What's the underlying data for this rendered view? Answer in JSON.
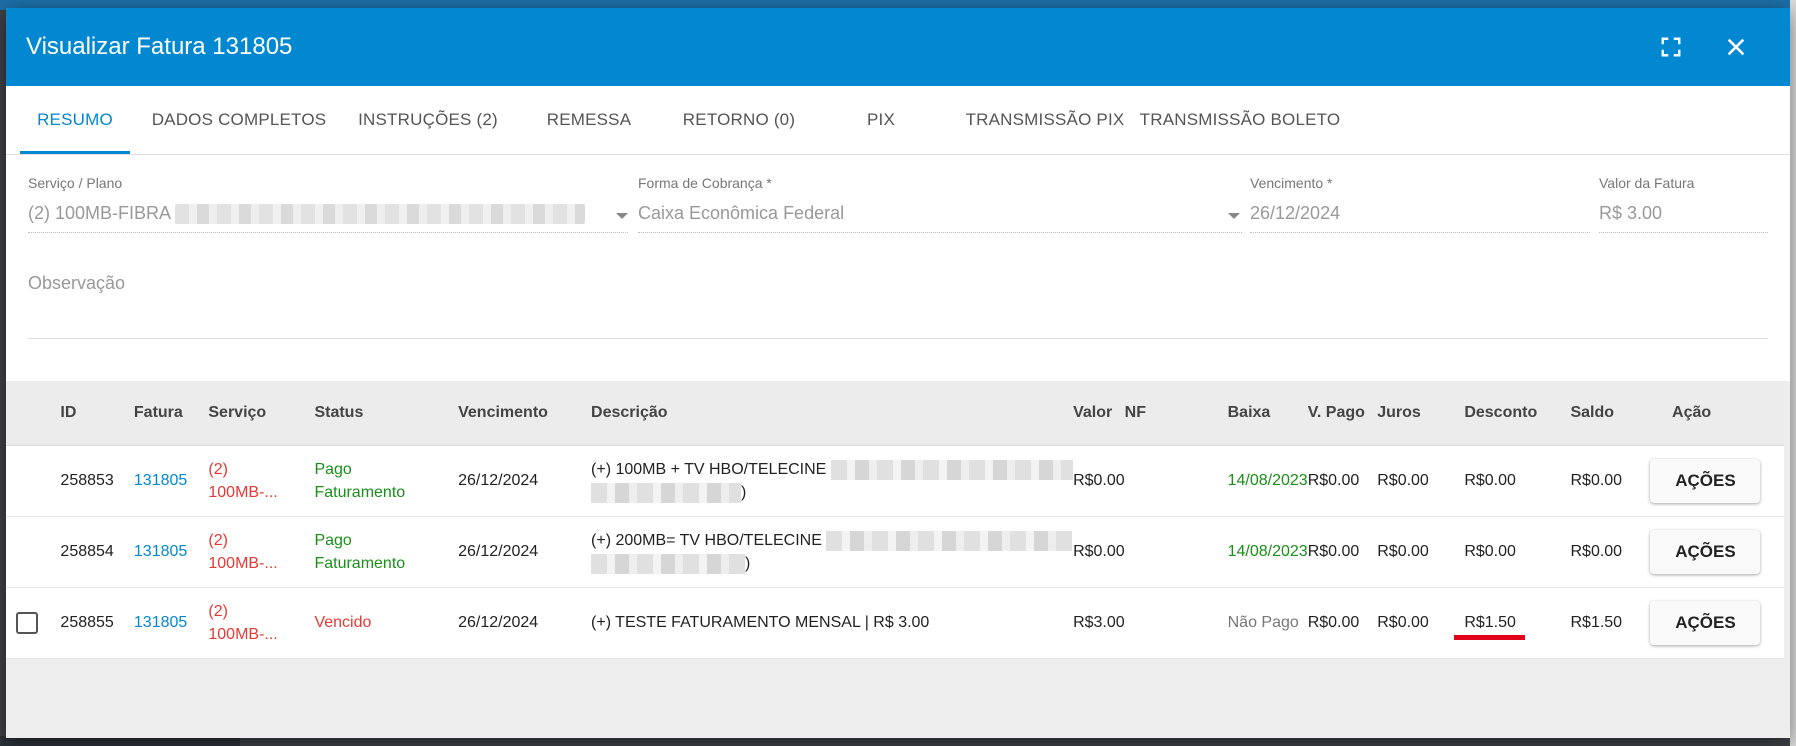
{
  "header": {
    "title": "Visualizar Fatura 131805",
    "fullscreen_icon": "fullscreen-icon",
    "close_icon": "close-icon"
  },
  "tabs": [
    {
      "label": "RESUMO",
      "active": true
    },
    {
      "label": "DADOS COMPLETOS"
    },
    {
      "label": "INSTRUÇÕES (2)"
    },
    {
      "label": "REMESSA"
    },
    {
      "label": "RETORNO (0)"
    },
    {
      "label": "PIX"
    },
    {
      "label": "TRANSMISSÃO PIX"
    },
    {
      "label": "TRANSMISSÃO BOLETO"
    }
  ],
  "form": {
    "servico": {
      "label": "Serviço / Plano",
      "value": "(2) 100MB-FIBRA"
    },
    "forma": {
      "label": "Forma de Cobrança *",
      "value": "Caixa Econômica Federal"
    },
    "vencimento": {
      "label": "Vencimento *",
      "value": "26/12/2024"
    },
    "valor": {
      "label": "Valor da Fatura",
      "value": "R$ 3.00"
    },
    "observacao": {
      "placeholder": "Observação"
    }
  },
  "table": {
    "headers": [
      "ID",
      "Fatura",
      "Serviço",
      "Status",
      "Vencimento",
      "Descrição",
      "Valor",
      "NF",
      "Baixa",
      "V. Pago",
      "Juros",
      "Desconto",
      "Saldo",
      "Ação"
    ],
    "rows": [
      {
        "id": "258853",
        "fatura": "131805",
        "servico_1": "(2)",
        "servico_2": "100MB-...",
        "status_1": "Pago",
        "status_2": "Faturamento",
        "vencimento": "26/12/2024",
        "descricao_1": "(+) 100MB + TV HBO/TELECINE",
        "descricao_2": ")",
        "valor": "R$0.00",
        "nf": "",
        "baixa": "14/08/2023",
        "v_pago": "R$0.00",
        "juros": "R$0.00",
        "desconto": "R$0.00",
        "saldo": "R$0.00",
        "acao": "AÇÕES"
      },
      {
        "id": "258854",
        "fatura": "131805",
        "servico_1": "(2)",
        "servico_2": "100MB-...",
        "status_1": "Pago",
        "status_2": "Faturamento",
        "vencimento": "26/12/2024",
        "descricao_1": "(+) 200MB= TV HBO/TELECINE",
        "descricao_2": ")",
        "valor": "R$0.00",
        "nf": "",
        "baixa": "14/08/2023",
        "v_pago": "R$0.00",
        "juros": "R$0.00",
        "desconto": "R$0.00",
        "saldo": "R$0.00",
        "acao": "AÇÕES"
      },
      {
        "id": "258855",
        "fatura": "131805",
        "servico_1": "(2)",
        "servico_2": "100MB-...",
        "status": "Vencido",
        "vencimento": "26/12/2024",
        "descricao": "(+) TESTE FATURAMENTO MENSAL | R$ 3.00",
        "valor": "R$3.00",
        "nf": "",
        "baixa": "Não Pago",
        "v_pago": "R$0.00",
        "juros": "R$0.00",
        "desconto": "R$1.50",
        "saldo": "R$1.50",
        "acao": "AÇÕES"
      }
    ]
  },
  "colors": {
    "primary": "#0288d1",
    "paid": "#1a8f1a",
    "overdue": "#e53935",
    "annotation": "#e3001b"
  }
}
